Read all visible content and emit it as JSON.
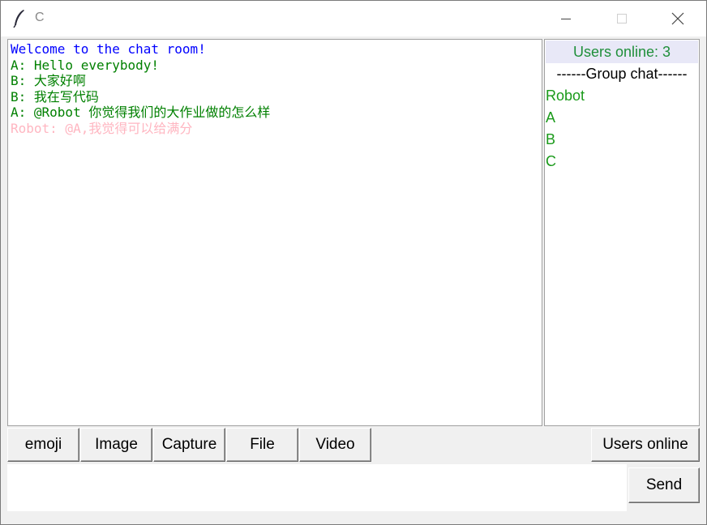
{
  "window": {
    "title": "C",
    "colors": {
      "titlebar": "#ffffff",
      "body": "#f0f0f0"
    }
  },
  "chat": {
    "messages": [
      {
        "text": "Welcome to the chat room!",
        "color": "#0000ff"
      },
      {
        "text": "A: Hello everybody!",
        "color": "#008000"
      },
      {
        "text": "B: 大家好啊",
        "color": "#008000"
      },
      {
        "text": "B: 我在写代码",
        "color": "#008000"
      },
      {
        "text": "A: @Robot 你觉得我们的大作业做的怎么样",
        "color": "#008000"
      },
      {
        "text": "Robot: @A,我觉得可以给满分",
        "color": "#ffb6c1"
      }
    ]
  },
  "users": {
    "header": "Users online: 3",
    "group_chat": "------Group chat------",
    "list": [
      "Robot",
      "A",
      "B",
      "C"
    ]
  },
  "toolbar": {
    "emoji": "emoji",
    "image": "Image",
    "capture": "Capture",
    "file": "File",
    "video": "Video",
    "users_online": "Users online"
  },
  "input": {
    "value": ""
  },
  "send": "Send"
}
